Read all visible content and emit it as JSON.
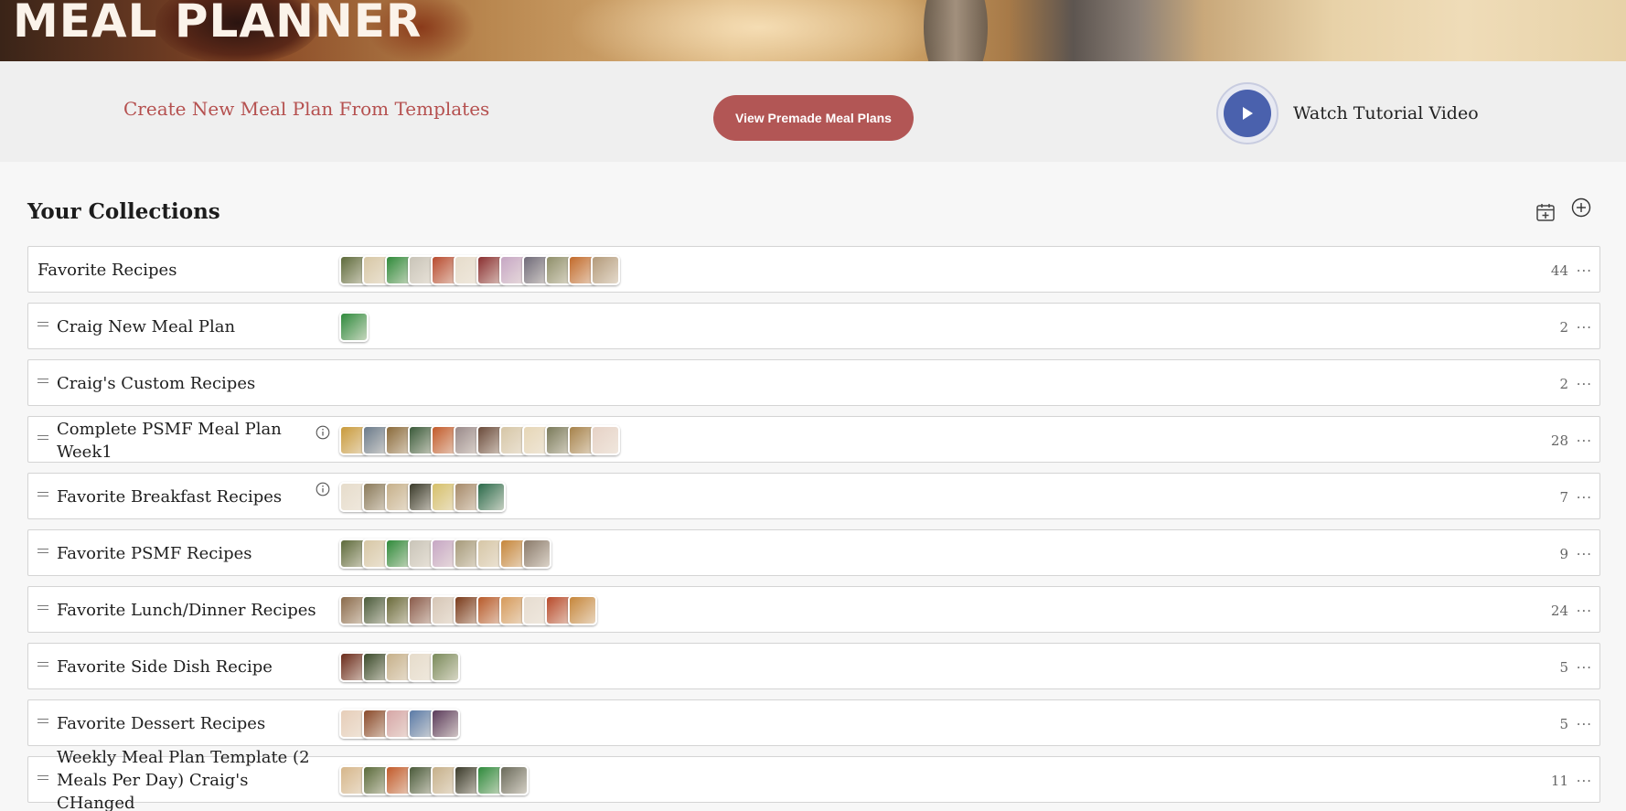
{
  "banner": {
    "title": "MEAL PLANNER"
  },
  "actions": {
    "template_link": "Create New Meal Plan From Templates",
    "premade_button": "View Premade Meal Plans",
    "tutorial_label": "Watch Tutorial Video"
  },
  "collections": {
    "title": "Your Collections",
    "rows": [
      {
        "name": "Favorite Recipes",
        "count": "44",
        "draggable": false,
        "info": false,
        "thumbs": [
          "#5d6a3a",
          "#d7c7a5",
          "#2f8a3a",
          "#c9c4b8",
          "#b84a2e",
          "#e6dccb",
          "#8a2f30",
          "#c6a6c4",
          "#6f6a78",
          "#8f8f6a",
          "#c26a2a",
          "#b39a7a"
        ]
      },
      {
        "name": "Craig New Meal Plan",
        "count": "2",
        "draggable": true,
        "info": false,
        "thumbs": [
          "#2e8a3c"
        ]
      },
      {
        "name": "Craig's Custom Recipes",
        "count": "2",
        "draggable": true,
        "info": false,
        "thumbs": []
      },
      {
        "name": "Complete PSMF Meal Plan Week1",
        "count": "28",
        "draggable": true,
        "info": true,
        "thumbs": [
          "#c99a3a",
          "#6a7a8a",
          "#8a6a3a",
          "#3a5a3a",
          "#c25a2a",
          "#9a8a8a",
          "#6a4a3a",
          "#d6c6a6",
          "#e6d6b6",
          "#7a7a5a",
          "#a6824a",
          "#e6d2c6"
        ]
      },
      {
        "name": "Favorite Breakfast Recipes",
        "count": "7",
        "draggable": true,
        "info": true,
        "thumbs": [
          "#e6dccb",
          "#8a7a5a",
          "#c6b08a",
          "#3a3a2a",
          "#d6c06a",
          "#a68a6a",
          "#2a6a4a"
        ]
      },
      {
        "name": "Favorite PSMF Recipes",
        "count": "9",
        "draggable": true,
        "info": false,
        "thumbs": [
          "#5d6a3a",
          "#d7c7a5",
          "#2f8a3a",
          "#c9c4b8",
          "#c6a6c4",
          "#a69a7a",
          "#d6c6a6",
          "#c6863a",
          "#8a7a6a"
        ]
      },
      {
        "name": "Favorite Lunch/Dinner Recipes",
        "count": "24",
        "draggable": true,
        "info": false,
        "thumbs": [
          "#8a6a4a",
          "#4a5a3a",
          "#6a6a3a",
          "#8a5a4a",
          "#d6c6b6",
          "#7a3a1a",
          "#b85a2a",
          "#d69a5a",
          "#e6dcd0",
          "#b84a2a",
          "#c6863a"
        ]
      },
      {
        "name": "Favorite Side Dish Recipe",
        "count": "5",
        "draggable": true,
        "info": false,
        "thumbs": [
          "#6a2a1a",
          "#3a4a2a",
          "#c6b08a",
          "#e6dccb",
          "#7a8a5a"
        ]
      },
      {
        "name": "Favorite Dessert Recipes",
        "count": "5",
        "draggable": true,
        "info": false,
        "thumbs": [
          "#e6cdb8",
          "#8a4a2a",
          "#d6a6a6",
          "#5a7aa6",
          "#5a3a5a"
        ]
      },
      {
        "name": "Weekly Meal Plan Template (2 Meals Per Day) Craig's CHanged",
        "count": "11",
        "draggable": true,
        "info": false,
        "thumbs": [
          "#d6b68a",
          "#5a6a3a",
          "#c25a2a",
          "#4a5a3a",
          "#c6b08a",
          "#3a3a2a",
          "#2e8a3c",
          "#6a6a5a"
        ]
      }
    ]
  },
  "colors": {
    "accent": "#b25655",
    "link": "#b5504f",
    "play": "#4a61ad"
  },
  "icons": [
    "play-icon",
    "calendar-plus-icon",
    "plus-circle-icon",
    "drag-handle-icon",
    "info-icon",
    "more-icon"
  ]
}
